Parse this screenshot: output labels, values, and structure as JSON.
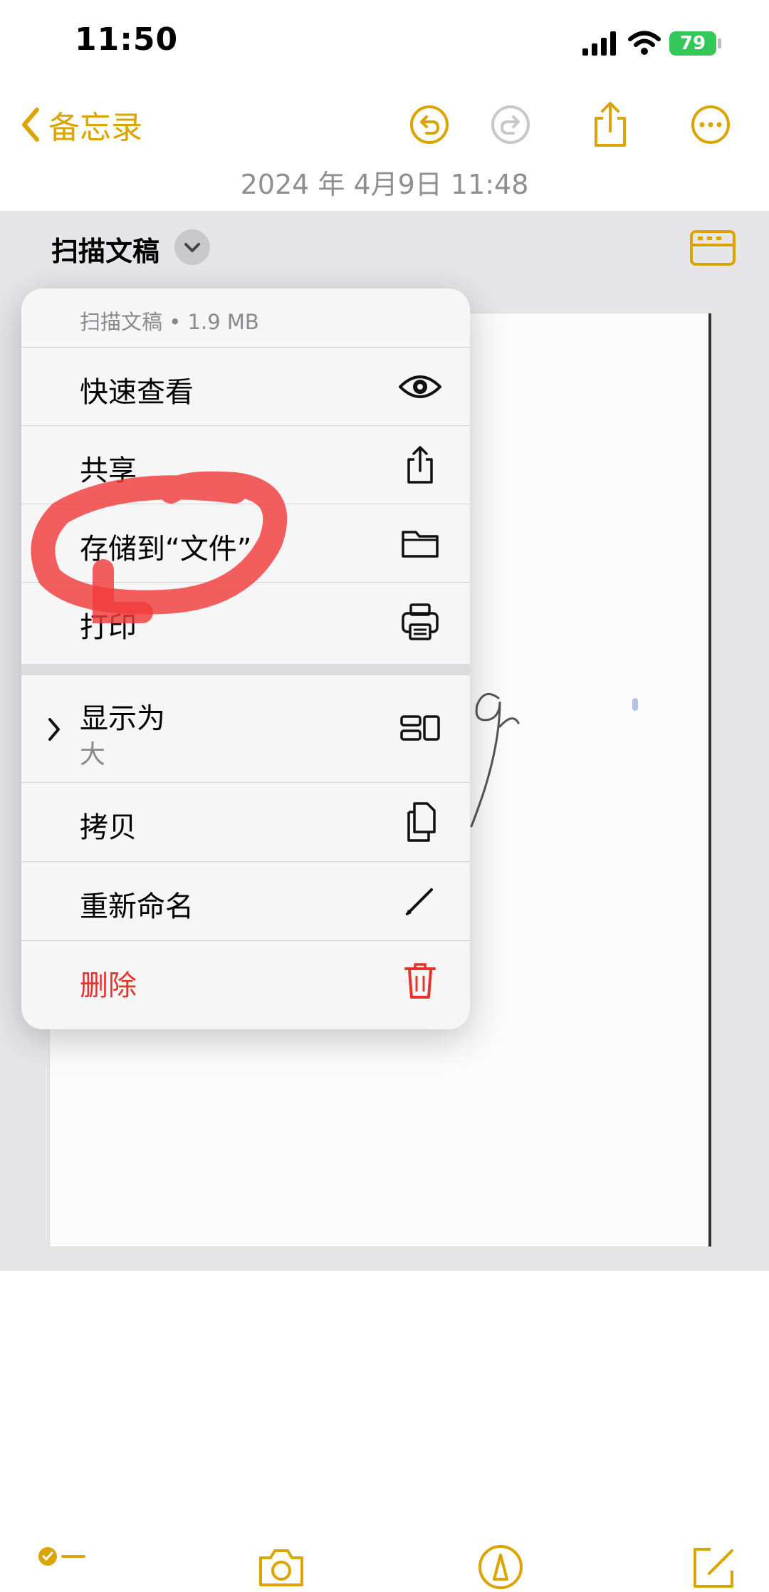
{
  "status_bar": {
    "time": "11:50",
    "battery": "79"
  },
  "nav": {
    "back_label": "备忘录",
    "date": "2024 年 4月9日 11:48"
  },
  "attachment": {
    "title": "扫描文稿"
  },
  "menu": {
    "header": "扫描文稿 • 1.9 MB",
    "items": [
      {
        "label": "快速查看",
        "icon": "eye-icon"
      },
      {
        "label": "共享",
        "icon": "share-icon"
      },
      {
        "label": "存储到“文件”",
        "icon": "folder-icon"
      },
      {
        "label": "打印",
        "icon": "printer-icon"
      },
      {
        "label": "显示为",
        "sublabel": "大",
        "icon": "display-layout-icon"
      },
      {
        "label": "拷贝",
        "icon": "copy-icon"
      },
      {
        "label": "重新命名",
        "icon": "pencil-icon"
      },
      {
        "label": "删除",
        "icon": "trash-icon"
      }
    ]
  },
  "colors": {
    "accent": "#dba400",
    "destructive": "#e5322d",
    "battery": "#34c759",
    "annotation": "#f03a3a"
  }
}
